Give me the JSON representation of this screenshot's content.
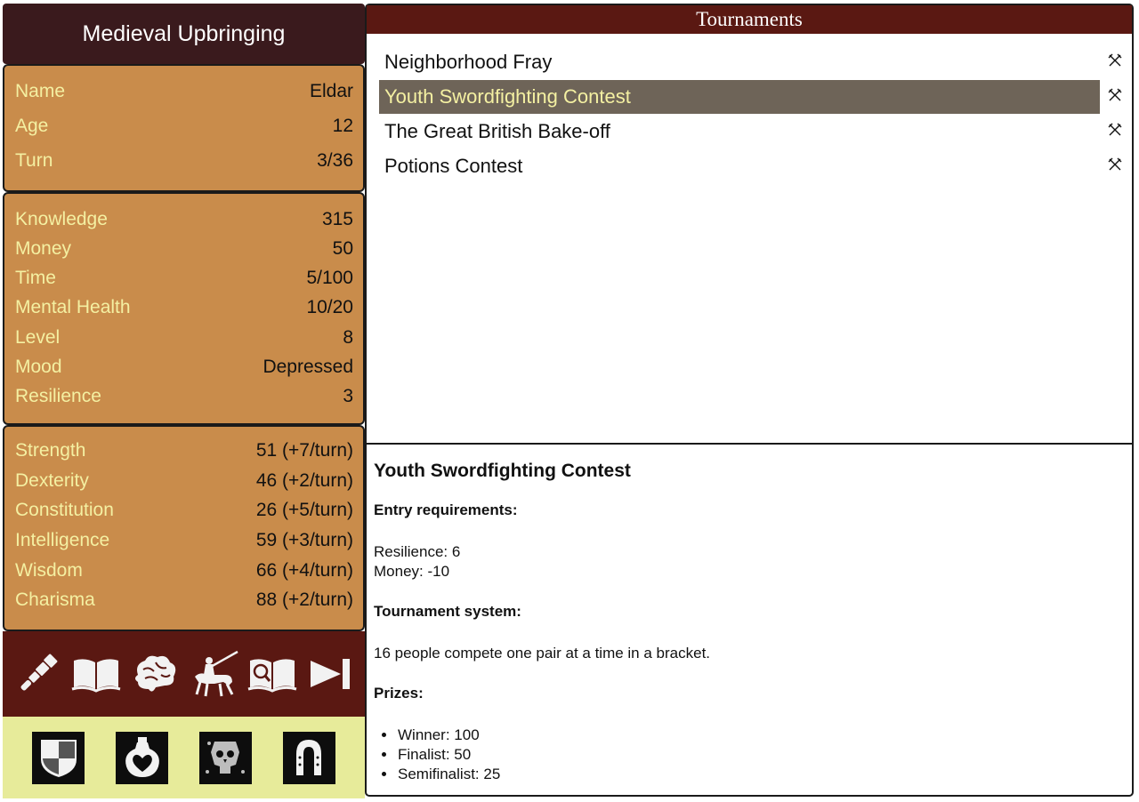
{
  "game": {
    "title": "Medieval Upbringing"
  },
  "basic": [
    {
      "label": "Name",
      "value": "Eldar"
    },
    {
      "label": "Age",
      "value": "12"
    },
    {
      "label": "Turn",
      "value": "3/36"
    }
  ],
  "resources": [
    {
      "label": "Knowledge",
      "value": "315"
    },
    {
      "label": "Money",
      "value": "50"
    },
    {
      "label": "Time",
      "value": "5/100"
    },
    {
      "label": "Mental Health",
      "value": "10/20"
    },
    {
      "label": "Level",
      "value": "8"
    },
    {
      "label": "Mood",
      "value": "Depressed"
    },
    {
      "label": "Resilience",
      "value": "3"
    }
  ],
  "attributes": [
    {
      "label": "Strength",
      "value": "51 (+7/turn)"
    },
    {
      "label": "Dexterity",
      "value": "46 (+2/turn)"
    },
    {
      "label": "Constitution",
      "value": "26 (+5/turn)"
    },
    {
      "label": "Intelligence",
      "value": "59 (+3/turn)"
    },
    {
      "label": "Wisdom",
      "value": "66 (+4/turn)"
    },
    {
      "label": "Charisma",
      "value": "88 (+2/turn)"
    }
  ],
  "actions": [
    "telescope-icon",
    "open-book-icon",
    "brain-icon",
    "knight-jousting-icon",
    "book-search-icon",
    "next-turn-icon"
  ],
  "status_icons": [
    "shield-icon",
    "heart-potion-icon",
    "skull-crest-icon",
    "horseshoe-icon"
  ],
  "tournaments": {
    "header": "Tournaments",
    "items": [
      {
        "name": "Neighborhood Fray",
        "selected": false
      },
      {
        "name": "Youth Swordfighting Contest",
        "selected": true
      },
      {
        "name": "The Great British Bake-off",
        "selected": false
      },
      {
        "name": "Potions Contest",
        "selected": false
      }
    ]
  },
  "detail": {
    "title": "Youth Swordfighting Contest",
    "req_heading": "Entry requirements:",
    "requirements": [
      "Resilience: 6",
      "Money: -10"
    ],
    "system_heading": "Tournament system:",
    "system_text": "16 people compete one pair at a time in a bracket.",
    "prizes_heading": "Prizes:",
    "prizes": [
      "Winner: 100",
      "Finalist: 50",
      "Semifinalist: 25"
    ]
  },
  "colors": {
    "title_bg": "#3a1a1d",
    "panel_bg": "#c98c4b",
    "label_yellow": "#f4f0a2",
    "maroon": "#5a1812",
    "selected_row": "#6e6458",
    "status_bg": "#e7eb9a"
  }
}
